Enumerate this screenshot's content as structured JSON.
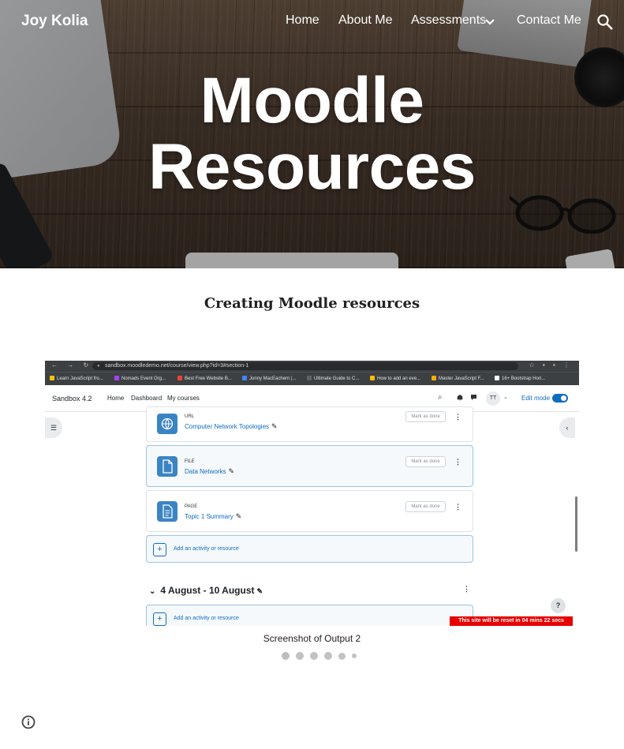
{
  "site": {
    "title": "Joy Kolia"
  },
  "nav": {
    "items": [
      {
        "label": "Home"
      },
      {
        "label": "About Me"
      },
      {
        "label": "Assessments"
      },
      {
        "label": "Contact Me"
      }
    ]
  },
  "hero": {
    "title_line1": "Moodle",
    "title_line2": "Resources"
  },
  "main": {
    "heading": "Creating Moodle resources"
  },
  "screenshot": {
    "browser": {
      "url": "sandbox.moodledemo.net/course/view.php?id=3#section-1",
      "bookmarks": [
        {
          "label": "Learn JavaScript fro...",
          "color": "#f4c20d"
        },
        {
          "label": "Nomads Event Org...",
          "color": "#a142f4"
        },
        {
          "label": "Best Free Website B...",
          "color": "#ea4335"
        },
        {
          "label": "Jonny MacEachern |...",
          "color": "#4285f4"
        },
        {
          "label": "Ultimate Guide to C...",
          "color": "#5f6368"
        },
        {
          "label": "How to add an eve...",
          "color": "#fbbc04"
        },
        {
          "label": "Master JavaScript F...",
          "color": "#f9ab00"
        },
        {
          "label": "16+ Bootstrap Hori...",
          "color": "#ffffff"
        }
      ]
    },
    "moodle_nav": {
      "brand": "Sandbox 4.2",
      "links": [
        "Home",
        "Dashboard",
        "My courses"
      ],
      "avatar": "TT",
      "edit_mode": "Edit mode",
      "edit_mode_on": true
    },
    "activities": [
      {
        "type": "URL",
        "name": "Computer Network Topologies",
        "mark_label": "Mark as done"
      },
      {
        "type": "FILE",
        "name": "Data Networks",
        "mark_label": "Mark as done"
      },
      {
        "type": "PAGE",
        "name": "Topic 1 Summary",
        "mark_label": "Mark as done"
      }
    ],
    "add_activity_label": "Add an activity or resource",
    "week_title": "4 August - 10 August",
    "help_label": "?",
    "reset_banner": "This site will be reset in 04 mins 22 secs"
  },
  "caption": "Screenshot of Output 2",
  "carousel": {
    "count": 6,
    "active_index": 0
  },
  "colors": {
    "accent": "#0f6cbf",
    "banner": "#e60000",
    "icon_blue": "#3b84c4"
  }
}
